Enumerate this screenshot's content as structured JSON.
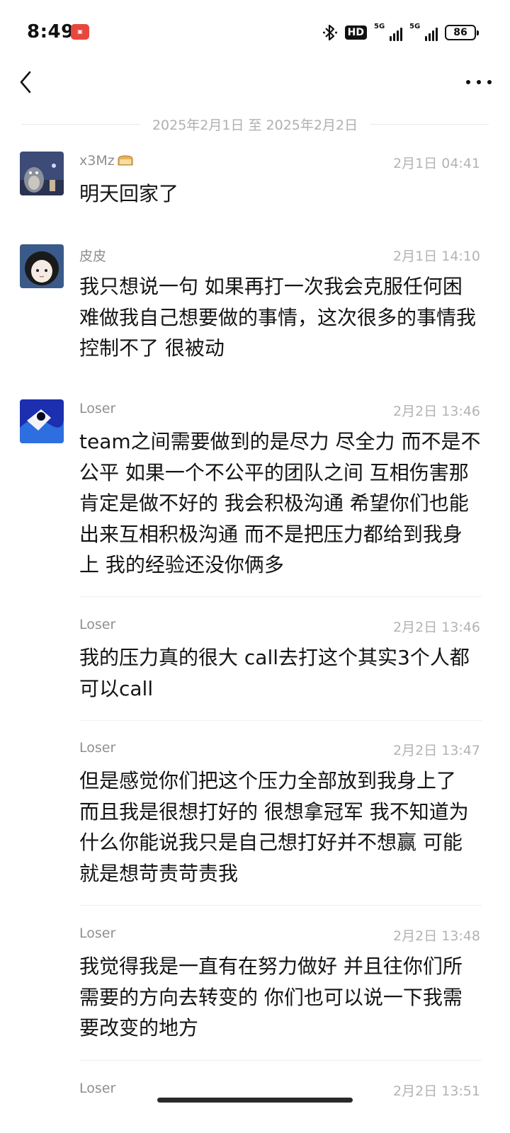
{
  "status_bar": {
    "time": "8:49",
    "app_icon": "app-notification-icon",
    "hd_label": "HD",
    "sim1_label": "5G",
    "sim2_label": "5G",
    "battery": "86"
  },
  "header": {
    "back_icon": "chevron-left-icon",
    "more_icon": "more-horizontal-icon"
  },
  "date_range": "2025年2月1日 至 2025年2月2日",
  "messages": [
    {
      "sender": "x3Mz",
      "time": "2月1日 04:41",
      "text": "明天回家了"
    },
    {
      "sender": "皮皮",
      "time": "2月1日 14:10",
      "text": "我只想说一句 如果再打一次我会克服任何困难做我自己想要做的事情，这次很多的事情我控制不了 很被动"
    },
    {
      "sender": "Loser",
      "time": "2月2日 13:46",
      "text": "team之间需要做到的是尽力 尽全力 而不是不公平 如果一个不公平的团队之间 互相伤害那肯定是做不好的 我会积极沟通 希望你们也能出来互相积极沟通 而不是把压力都给到我身上 我的经验还没你俩多"
    },
    {
      "sender": "Loser",
      "time": "2月2日 13:46",
      "text": "我的压力真的很大 call去打这个其实3个人都可以call"
    },
    {
      "sender": "Loser",
      "time": "2月2日 13:47",
      "text": "但是感觉你们把这个压力全部放到我身上了 而且我是很想打好的 很想拿冠军 我不知道为什么你能说我只是自己想打好并不想赢 可能就是想苛责苛责我"
    },
    {
      "sender": "Loser",
      "time": "2月2日 13:48",
      "text": "我觉得我是一直有在努力做好 并且往你们所需要的方向去转变的 你们也可以说一下我需要改变的地方"
    },
    {
      "sender": "Loser",
      "time": "2月2日 13:51",
      "text": ""
    }
  ]
}
